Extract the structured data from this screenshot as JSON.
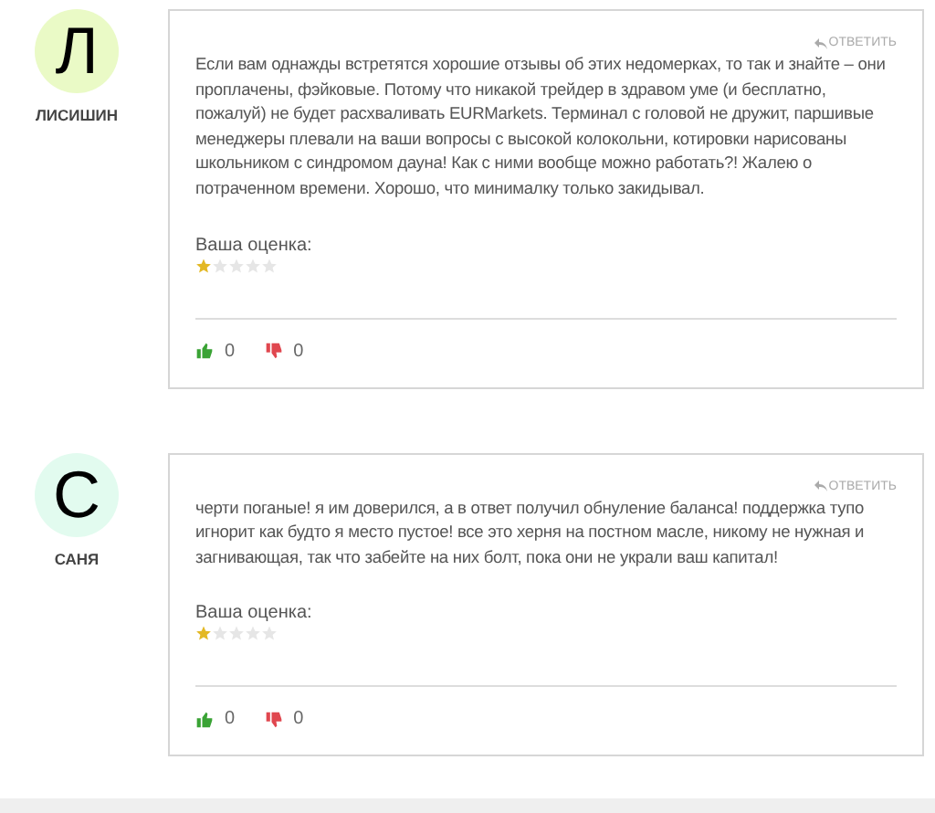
{
  "reviews": [
    {
      "avatar_letter": "Л",
      "color": "#eafac6",
      "author": "ЛИСИШИН",
      "reply": "ОТВЕТИТЬ",
      "text": "Если вам однажды встретятся хорошие отзывы об этих недомерках, то так и знайте – они проплачены, фэйковые. Потому что никакой трейдер в здравом уме (и бесплатно, пожалуй) не будет расхваливать EURMarkets. Терминал с головой не дружит, паршивые менеджеры плевали на ваши вопросы с высокой колокольни, котировки нарисованы школьником с синдромом дауна! Как с ними вообще можно работать?! Жалею о потраченном времени. Хорошо, что минималку только закидывал.",
      "rating_label": "Ваша оценка:",
      "stars": 1,
      "likes": "0",
      "dislikes": "0"
    },
    {
      "avatar_letter": "С",
      "color": "#e2fbef",
      "author": "САНЯ",
      "reply": "ОТВЕТИТЬ",
      "text": "черти поганые! я им доверился, а в ответ получил обнуление баланса! поддержка тупо игнорит как будто я место пустое! все это херня на постном масле, никому не нужная и загнивающая, так что забейте на них болт, пока они не украли ваш капитал!",
      "rating_label": "Ваша оценка:",
      "stars": 1,
      "likes": "0",
      "dislikes": "0"
    }
  ]
}
